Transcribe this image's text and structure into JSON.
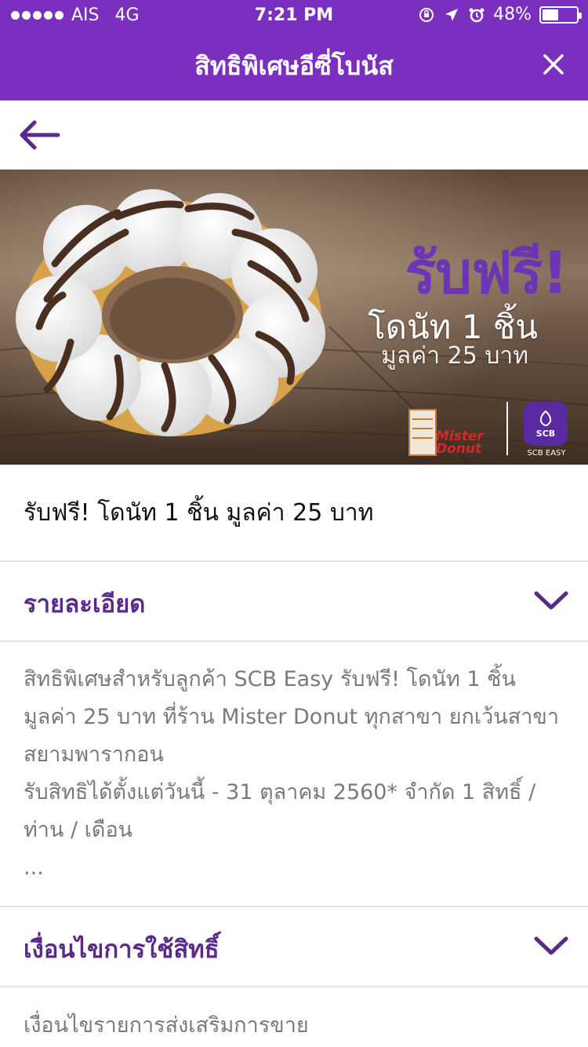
{
  "status_bar": {
    "carrier": "AIS",
    "network": "4G",
    "time": "7:21 PM",
    "battery_percent": "48%",
    "battery_level": 0.48,
    "icons": [
      "orientation-lock-icon",
      "location-arrow-icon",
      "alarm-icon",
      "battery-icon"
    ]
  },
  "header": {
    "title": "สิทธิพิเศษอีซี่โบนัส",
    "close_icon": "close-icon",
    "background": "#7b2fbe"
  },
  "nav": {
    "back_icon": "back-arrow-icon"
  },
  "banner": {
    "headline": "รับฟรี!",
    "line1": "โดนัท 1 ชิ้น",
    "line2": "มูลค่า 25 บาท",
    "mister_donut_logo": "Mister\nDonut",
    "scb_badge": "SCB",
    "scb_caption": "SCB EASY"
  },
  "promo": {
    "title": "รับฟรี! โดนัท 1 ชิ้น มูลค่า 25 บาท"
  },
  "details_section": {
    "title": "รายละเอียด",
    "body": "สิทธิพิเศษสำหรับลูกค้า SCB Easy รับฟรี! โดนัท 1 ชิ้น\nมูลค่า 25 บาท ที่ร้าน Mister Donut ทุกสาขา ยกเว้นสาขา\nสยามพารากอน\nรับสิทธิได้ตั้งแต่วันนี้ - 31 ตุลาคม 2560* จำกัด 1 สิทธิ์ /\nท่าน / เดือน",
    "ellipsis": "..."
  },
  "conditions_section": {
    "title": "เงื่อนไขการใช้สิทธิ์",
    "body": "เงื่อนไขรายการส่งเสริมการขาย"
  },
  "colors": {
    "accent_purple": "#7b2fbe",
    "section_title": "#5a2a8a",
    "body_gray": "#7a7a7a"
  }
}
